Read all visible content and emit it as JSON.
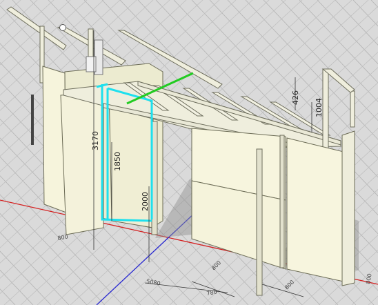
{
  "dimensions": {
    "height_total": "3170",
    "height_opening": "1850",
    "door_height": "2000",
    "rail_offset": "426",
    "rail_height": "1004",
    "width_total": "5080",
    "segment_a": "780",
    "segment_b": "800",
    "segment_c": "800",
    "segment_d": "800",
    "left_base": "800"
  },
  "colors": {
    "background": "#dadada",
    "grid": "#b3b3b3",
    "panel": "#f6f4dc",
    "panel_edge": "#6b6b55",
    "steel": "#efeedd",
    "selection": "#1ee0ee",
    "axis_x": "#d42020",
    "axis_y": "#2828d0",
    "axis_green": "#22cc22"
  }
}
